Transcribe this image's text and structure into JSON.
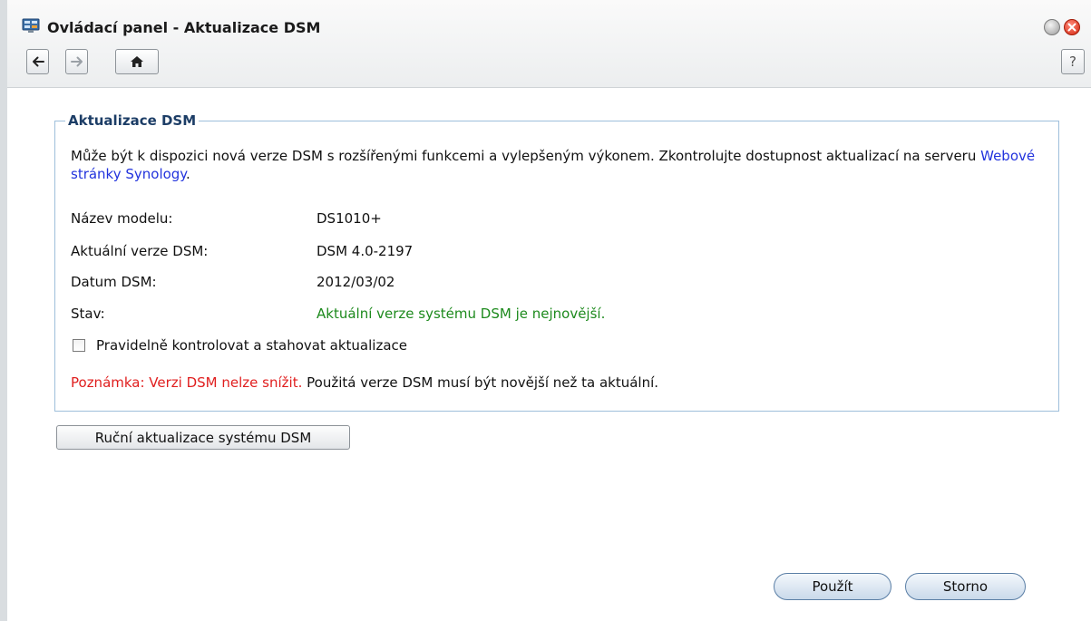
{
  "window": {
    "title": "Ovládací panel - Aktualizace DSM",
    "help_label": "?"
  },
  "section": {
    "legend": "Aktualizace DSM",
    "intro_text": "Může být k dispozici nová verze DSM s rozšířenými funkcemi a vylepšeným výkonem. Zkontrolujte dostupnost aktualizací na serveru ",
    "intro_link": "Webové stránky Synology",
    "intro_end": "."
  },
  "info": [
    {
      "label": "Název modelu:",
      "value": "DS1010+"
    },
    {
      "label": "Aktuální verze DSM:",
      "value": "DSM 4.0-2197"
    },
    {
      "label": "Datum DSM:",
      "value": "2012/03/02"
    },
    {
      "label": "Stav:",
      "value": "Aktuální verze systému DSM je nejnovější."
    }
  ],
  "auto_update": {
    "label": "Pravidelně kontrolovat a stahovat aktualizace",
    "checked": false
  },
  "note": {
    "warning": "Poznámka: Verzi DSM nelze snížit.",
    "text": " Použitá verze DSM musí být novější než ta aktuální."
  },
  "buttons": {
    "manual_update": "Ruční aktualizace systému DSM",
    "apply": "Použít",
    "cancel": "Storno"
  },
  "colors": {
    "status_ok": "#1d8a1d",
    "warning": "#e01e1e",
    "link": "#2233dd",
    "legend": "#1c3d66"
  }
}
